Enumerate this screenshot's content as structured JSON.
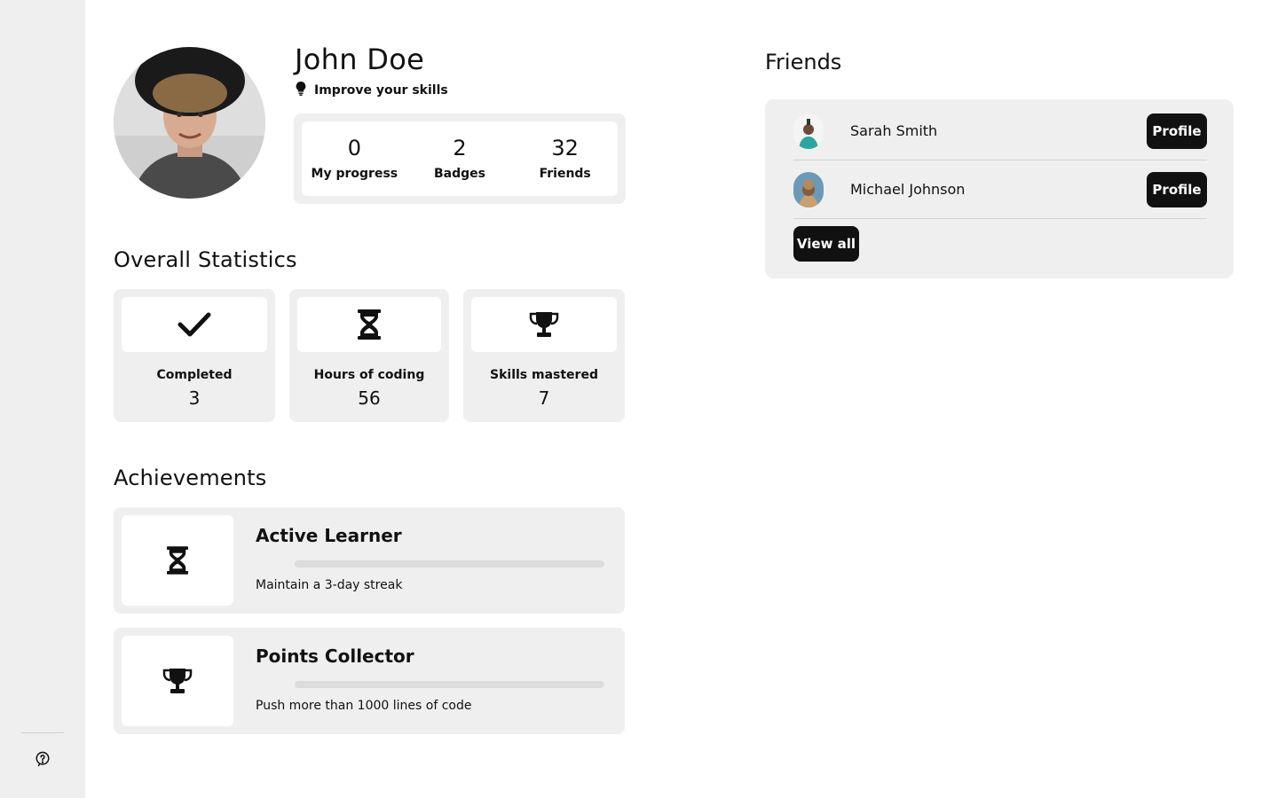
{
  "profile": {
    "name": "John Doe",
    "tagline": "Improve your skills",
    "stats": [
      {
        "value": "0",
        "label": "My progress"
      },
      {
        "value": "2",
        "label": "Badges"
      },
      {
        "value": "32",
        "label": "Friends"
      }
    ]
  },
  "overall": {
    "title": "Overall Statistics",
    "cards": [
      {
        "icon": "check-icon",
        "label": "Completed",
        "value": "3"
      },
      {
        "icon": "hourglass-icon",
        "label": "Hours of coding",
        "value": "56"
      },
      {
        "icon": "trophy-icon",
        "label": "Skills mastered",
        "value": "7"
      }
    ]
  },
  "achievements": {
    "title": "Achievements",
    "items": [
      {
        "icon": "hourglass-icon",
        "title": "Active Learner",
        "description": "Maintain a 3-day streak",
        "progress": 0
      },
      {
        "icon": "trophy-icon",
        "title": "Points Collector",
        "description": "Push more than 1000 lines of code",
        "progress": 0
      }
    ]
  },
  "friends": {
    "title": "Friends",
    "items": [
      {
        "name": "Sarah Smith",
        "button": "Profile"
      },
      {
        "name": "Michael Johnson",
        "button": "Profile"
      }
    ],
    "view_all": "View all"
  },
  "sidebar": {
    "help_icon": "help-icon"
  },
  "colors": {
    "panel": "#efefef",
    "button": "#111111",
    "accent_text": "#111111"
  }
}
